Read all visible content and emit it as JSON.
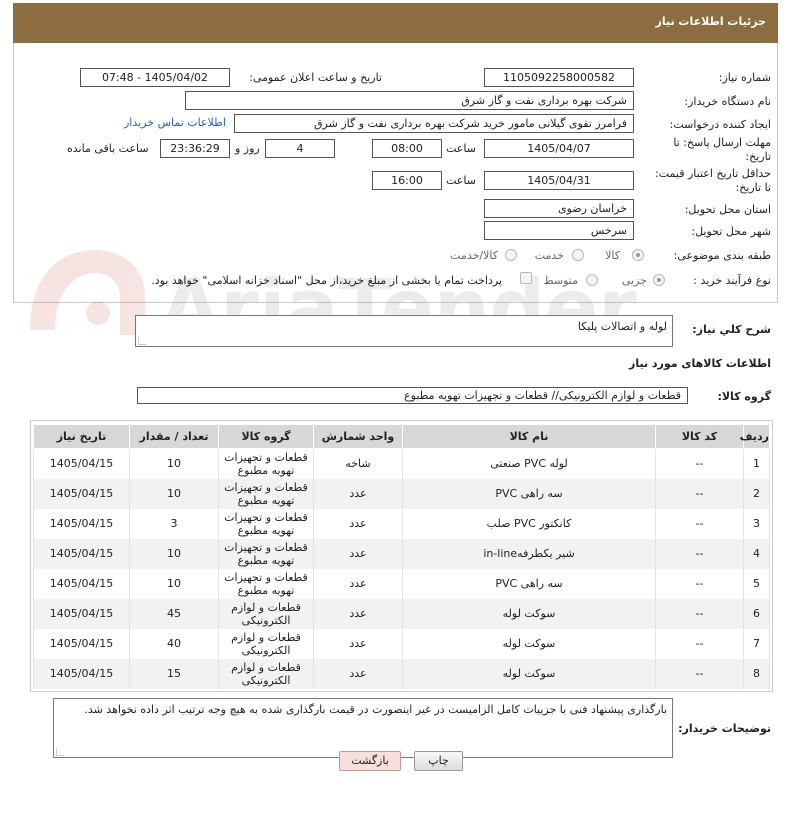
{
  "header": {
    "title": "جزئیات اطلاعات نیاز"
  },
  "form": {
    "need_number_label": "شماره نیاز:",
    "need_number": "1105092258000582",
    "announce_label": "تاریخ و ساعت اعلان عمومی:",
    "announce_value": "1405/04/02 - 07:48",
    "buyer_org_label": "نام دستگاه خریدار:",
    "buyer_org": "شرکت بهره برداری نفت و گاز شرق",
    "creator_label": "ایجاد کننده درخواست:",
    "creator": "فرامرز تقوی گیلانی مامور خرید شرکت بهره برداری نفت و گاز شرق",
    "contact_link": "اطلاعات تماس خریدار",
    "reply_deadline_label": "مهلت ارسال پاسخ: تا تاریخ:",
    "reply_date": "1405/04/07",
    "time_label": "ساعت",
    "reply_time": "08:00",
    "days_value": "4",
    "days_label": "روز و",
    "remaining_time": "23:36:29",
    "remaining_label": "ساعت باقی مانده",
    "price_validity_label": "حداقل تاریخ اعتبار قیمت: تا تاریخ:",
    "price_date": "1405/04/31",
    "time_label2": "ساعت",
    "price_time": "16:00",
    "province_label": "استان محل تحویل:",
    "province": "خراسان رضوی",
    "city_label": "شهر محل تحویل:",
    "city": "سرخس",
    "category_label": "طبقه بندی موضوعی:",
    "category_options": [
      "کالا",
      "خدمت",
      "کالا/خدمت"
    ],
    "process_label": "نوع فرآیند خرید :",
    "process_options": [
      "جزیی",
      "متوسط"
    ],
    "payment_note": "پرداخت تمام یا بخشی از مبلغ خرید،از محل \"اسناد خزانه اسلامی\" خواهد بود."
  },
  "summary": {
    "label": "شرح کلي نياز:",
    "value": "لوله و اتصالات پلیکا"
  },
  "goods_info": {
    "title": "اطلاعات کالاهای مورد نیاز",
    "group_label": "گروه کالا:",
    "group_value": "قطعات و لوازم الکترونیکی//  قطعات و تجهیزات تهویه مطبوع"
  },
  "table": {
    "headers": [
      "ردیف",
      "کد کالا",
      "نام کالا",
      "واحد شمارش",
      "گروه کالا",
      "تعداد / مقدار",
      "تاریخ نیاز"
    ],
    "rows": [
      [
        "1",
        "--",
        "لوله PVC صنعتی",
        "شاخه",
        "قطعات و تجهیزات تهویه مطبوع",
        "10",
        "1405/04/15"
      ],
      [
        "2",
        "--",
        "سه راهی PVC",
        "عدد",
        "قطعات و تجهیزات تهویه مطبوع",
        "10",
        "1405/04/15"
      ],
      [
        "3",
        "--",
        "کانکتور PVC صلب",
        "عدد",
        "قطعات و تجهیزات تهویه مطبوع",
        "3",
        "1405/04/15"
      ],
      [
        "4",
        "--",
        "شیر یکطرفهin-line",
        "عدد",
        "قطعات و تجهیزات تهویه مطبوع",
        "10",
        "1405/04/15"
      ],
      [
        "5",
        "--",
        "سه راهی PVC",
        "عدد",
        "قطعات و تجهیزات تهویه مطبوع",
        "10",
        "1405/04/15"
      ],
      [
        "6",
        "--",
        "سوکت لوله",
        "عدد",
        "قطعات و لوازم الکترونیکی",
        "45",
        "1405/04/15"
      ],
      [
        "7",
        "--",
        "سوکت لوله",
        "عدد",
        "قطعات و لوازم الکترونیکی",
        "40",
        "1405/04/15"
      ],
      [
        "8",
        "--",
        "سوکت لوله",
        "عدد",
        "قطعات و لوازم الکترونیکی",
        "15",
        "1405/04/15"
      ]
    ]
  },
  "buyer_notes": {
    "label": "توضیحات خریدار:",
    "value": "بارگذاری پیشنهاد فنی با جزییات کامل الزامیست در غیر اینصورت در قیمت بارگذاری شده به هیچ وجه ترتیب اثر داده نخواهد شد."
  },
  "buttons": {
    "print": "چاپ",
    "back": "بازگشت"
  },
  "watermark": {
    "text": "AriaTender.net"
  },
  "colors": {
    "header": "#8b6d3f",
    "link": "#2a5db0",
    "table_header": "#d7d7d7",
    "back_button": "#f9dede"
  }
}
